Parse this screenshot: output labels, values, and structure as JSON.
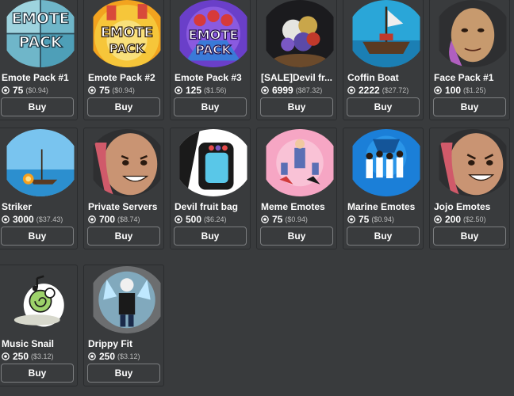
{
  "items": [
    {
      "name": "Emote Pack #1",
      "robux": "75",
      "usd": "($0.94)",
      "buy": "Buy",
      "thumb_text": [
        "EMOTE",
        "PACK"
      ]
    },
    {
      "name": "Emote Pack #2",
      "robux": "75",
      "usd": "($0.94)",
      "buy": "Buy",
      "thumb_text": [
        "EMOTE",
        "PACK"
      ]
    },
    {
      "name": "Emote Pack #3",
      "robux": "125",
      "usd": "($1.56)",
      "buy": "Buy",
      "thumb_text": [
        "EMOTE",
        "PACK"
      ]
    },
    {
      "name": "[SALE]Devil fr...",
      "robux": "6999",
      "usd": "($87.32)",
      "buy": "Buy"
    },
    {
      "name": "Coffin Boat",
      "robux": "2222",
      "usd": "($27.72)",
      "buy": "Buy"
    },
    {
      "name": "Face Pack #1",
      "robux": "100",
      "usd": "($1.25)",
      "buy": "Buy"
    },
    {
      "name": "Striker",
      "robux": "3000",
      "usd": "($37.43)",
      "buy": "Buy"
    },
    {
      "name": "Private Servers",
      "robux": "700",
      "usd": "($8.74)",
      "buy": "Buy"
    },
    {
      "name": "Devil fruit bag",
      "robux": "500",
      "usd": "($6.24)",
      "buy": "Buy"
    },
    {
      "name": "Meme Emotes",
      "robux": "75",
      "usd": "($0.94)",
      "buy": "Buy"
    },
    {
      "name": "Marine Emotes",
      "robux": "75",
      "usd": "($0.94)",
      "buy": "Buy"
    },
    {
      "name": "Jojo Emotes",
      "robux": "200",
      "usd": "($2.50)",
      "buy": "Buy"
    },
    {
      "name": "Music Snail",
      "robux": "250",
      "usd": "($3.12)",
      "buy": "Buy"
    },
    {
      "name": "Drippy Fit",
      "robux": "250",
      "usd": "($3.12)",
      "buy": "Buy"
    }
  ],
  "colors": {
    "background": "#393b3d",
    "card_border": "#2a2c2e",
    "button_border": "#7c7e80",
    "text": "#ffffff",
    "muted": "#bdbebe"
  }
}
